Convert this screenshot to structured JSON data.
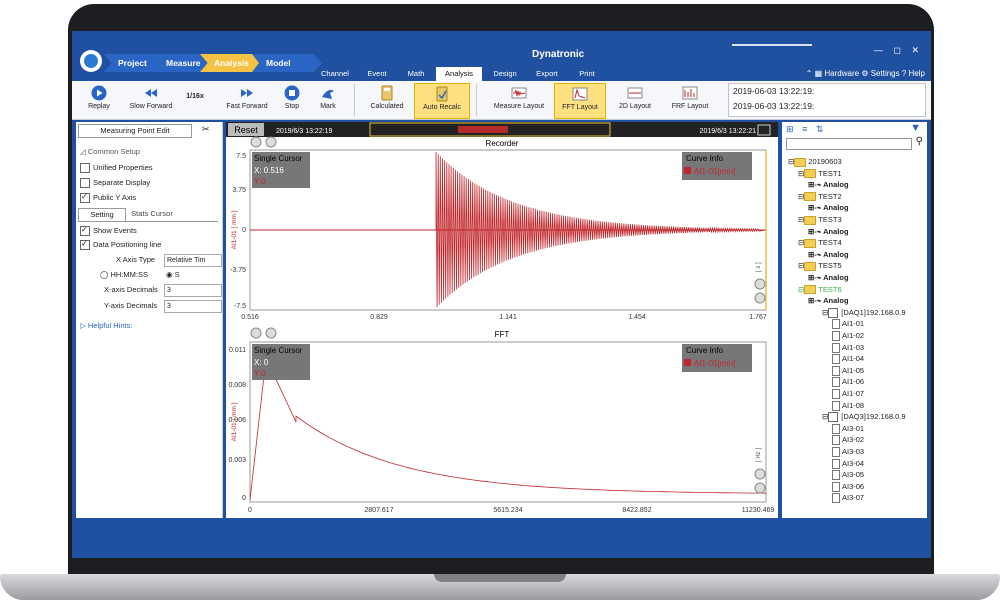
{
  "app": {
    "title": "Dynatronic",
    "window_controls": "— ◻ ✕"
  },
  "breadcrumb": [
    "Project",
    "Measure",
    "Analysis",
    "Model"
  ],
  "tabs": [
    "Channel",
    "Event",
    "Math",
    "Analysis",
    "Design",
    "Export",
    "Print"
  ],
  "topright": {
    "hardware": "Hardware",
    "settings": "Settings",
    "help": "Help"
  },
  "ribbon": {
    "replay": "Replay",
    "slow_forward": "Slow Forward",
    "speed": "1/16x",
    "fast_forward": "Fast Forward",
    "stop": "Stop",
    "mark": "Mark",
    "calculated": "Calculated",
    "auto_recalc": "Auto Recalc",
    "measure_layout": "Measure Layout",
    "fft_layout": "FFT Layout",
    "layout_2d": "2D Layout",
    "frf_layout": "FRF Layout",
    "times": [
      "2019-06-03 13:22:19:",
      "2019-06-03 13:22:19:"
    ]
  },
  "left_panel": {
    "header": "Measuring Point Edit",
    "section": "Common Setup",
    "unified": "Unified Properties",
    "separate": "Separate Display",
    "public_y": "Public Y Axis",
    "tab_setting": "Setting",
    "tab_stats": "Stats Cursor",
    "show_events": "Show Events",
    "data_positioning": "Data Positioning line",
    "x_axis_type_label": "X Axis Type",
    "x_axis_type_value": "Relative Tim",
    "radio_hhmmss": "HH:MM:SS",
    "radio_s": "S",
    "x_dec_label": "X-axis Decimals",
    "x_dec_value": "3",
    "y_dec_label": "Y-axis Decimals",
    "y_dec_value": "3",
    "hints": "Helpful Hints:"
  },
  "timeline": {
    "reset": "Reset",
    "start": "2019/6/3 13:22:19",
    "end": "2019/6/3 13:22:21"
  },
  "recorder": {
    "title": "Recorder",
    "cursor_title": "Single Cursor",
    "cursor_x": "X: 0.516",
    "cursor_y": "Y:0",
    "curve_info": "Curve Info",
    "curve_name": "AI1-01[mm]",
    "ylabel": "AI1-01 [ mm ]",
    "xunit": "[ s ]",
    "yticks": [
      "7.5",
      "3.75",
      "0",
      "-3.75",
      "-7.5"
    ],
    "xticks": [
      "0.516",
      "0.829",
      "1.141",
      "1.454",
      "1.767"
    ]
  },
  "fft": {
    "title": "FFT",
    "cursor_title": "Single Cursor",
    "cursor_x": "X: 0",
    "cursor_y": "Y:0",
    "curve_info": "Curve Info",
    "curve_name": "AI1-01[mm]",
    "ylabel": "AI1-01 [ mm ]",
    "xunit": "[ Hz ]",
    "yticks": [
      "0.011",
      "0.008",
      "0.006",
      "0.003",
      "0"
    ],
    "xticks": [
      "0",
      "2807.617",
      "5615.234",
      "8422.852",
      "11230.469"
    ]
  },
  "tree": {
    "root": "20190603",
    "tests": [
      "TEST1",
      "TEST2",
      "TEST3",
      "TEST4",
      "TEST5",
      "TEST6"
    ],
    "analog": "Analog",
    "daq1": "[DAQ1]192.168.0.9",
    "daq1_channels": [
      "AI1-01",
      "AI1-02",
      "AI1-03",
      "AI1-04",
      "AI1-05",
      "AI1-06",
      "AI1-07",
      "AI1-08"
    ],
    "daq3": "[DAQ3]192.168.0.9",
    "daq3_channels": [
      "AI3-01",
      "AI3-02",
      "AI3-03",
      "AI3-04",
      "AI3-05",
      "AI3-06",
      "AI3-07"
    ]
  },
  "colors": {
    "brand": "#2050a0",
    "curve": "#c0262b",
    "highlight": "#ffe080",
    "active_test": "#3cb043"
  }
}
